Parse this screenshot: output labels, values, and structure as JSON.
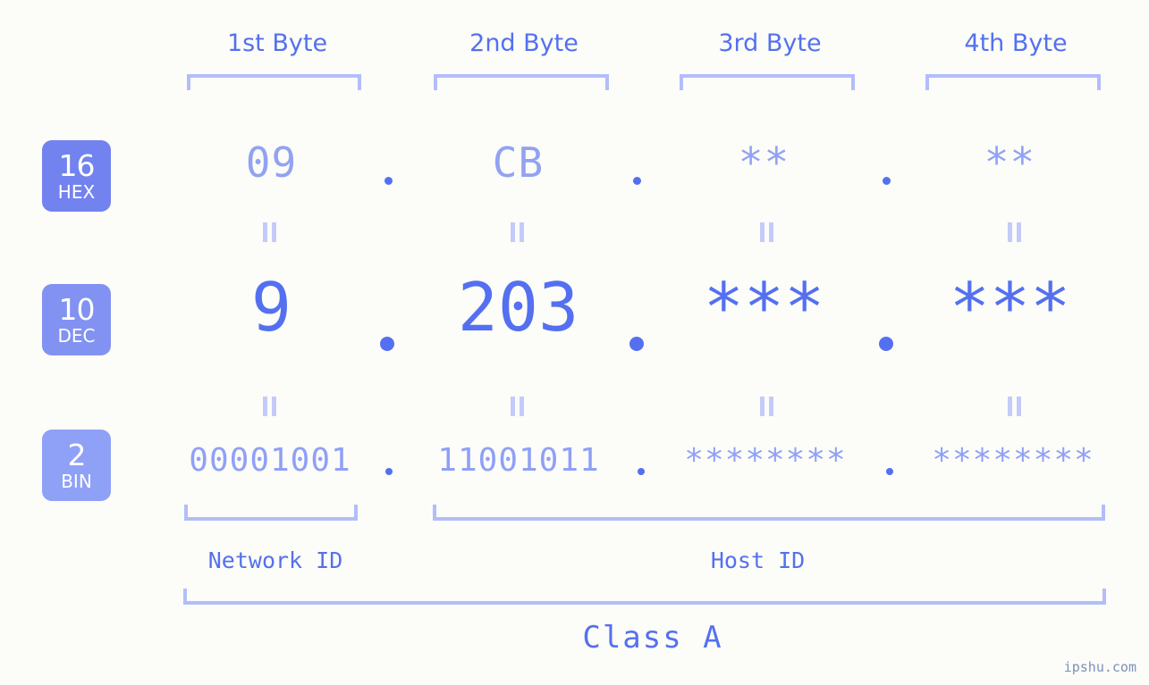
{
  "meta": {
    "watermark": "ipshu.com",
    "background_color": "#fcfdf8",
    "accent_color": "#5470f0",
    "light_accent_color": "#92a2f3",
    "bracket_color": "#b3bdfb"
  },
  "byte_headers": [
    {
      "label": "1st Byte"
    },
    {
      "label": "2nd Byte"
    },
    {
      "label": "3rd Byte"
    },
    {
      "label": "4th Byte"
    }
  ],
  "bases": [
    {
      "number": "16",
      "name": "HEX",
      "color": "#7283ef"
    },
    {
      "number": "10",
      "name": "DEC",
      "color": "#8292f2"
    },
    {
      "number": "2",
      "name": "BIN",
      "color": "#8fa0f7"
    }
  ],
  "rows": {
    "hex": {
      "base_number": "16",
      "base_name": "HEX",
      "values": [
        "09",
        "CB",
        "**",
        "**"
      ],
      "separator": "."
    },
    "dec": {
      "base_number": "10",
      "base_name": "DEC",
      "values": [
        "9",
        "203",
        "***",
        "***"
      ],
      "separator": "."
    },
    "bin": {
      "base_number": "2",
      "base_name": "BIN",
      "values": [
        "00001001",
        "11001011",
        "********",
        "********"
      ],
      "separator": "."
    }
  },
  "equality_marks": {
    "glyph": "=",
    "count_per_gap": 4
  },
  "sections": {
    "network_id": "Network ID",
    "host_id": "Host ID",
    "class": "Class A"
  }
}
